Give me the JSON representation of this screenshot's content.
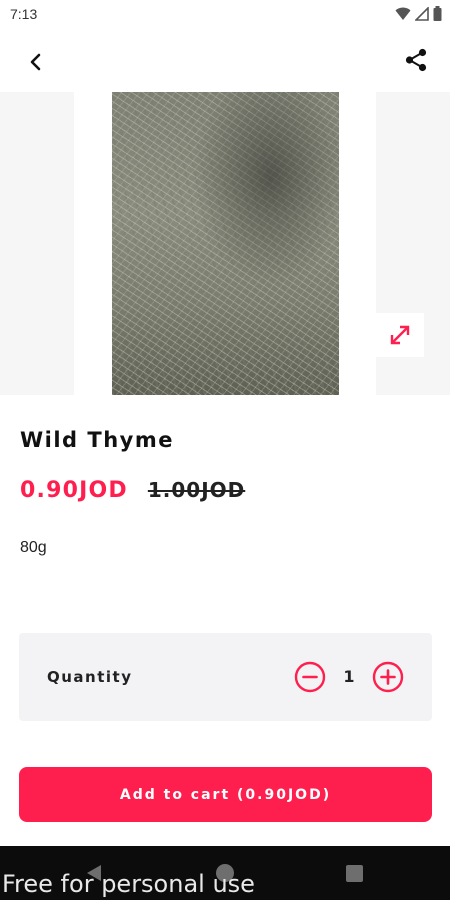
{
  "status_bar": {
    "time": "7:13"
  },
  "product": {
    "title": "Wild Thyme",
    "price_now": "0.90JOD",
    "price_old": "1.00JOD",
    "weight": "80g"
  },
  "quantity": {
    "label": "Quantity",
    "value": "1"
  },
  "add_to_cart": {
    "label": "Add to cart (0.90JOD)"
  },
  "watermark": "Free for personal use",
  "icons": [
    "back-arrow-icon",
    "share-icon",
    "expand-icon",
    "minus-circle-icon",
    "plus-circle-icon",
    "wifi-icon",
    "signal-icon",
    "battery-icon"
  ],
  "colors": {
    "accent": "#ff1f4f",
    "background": "#ffffff",
    "panel": "#f3f3f5",
    "nav": "#0c0c0c"
  }
}
